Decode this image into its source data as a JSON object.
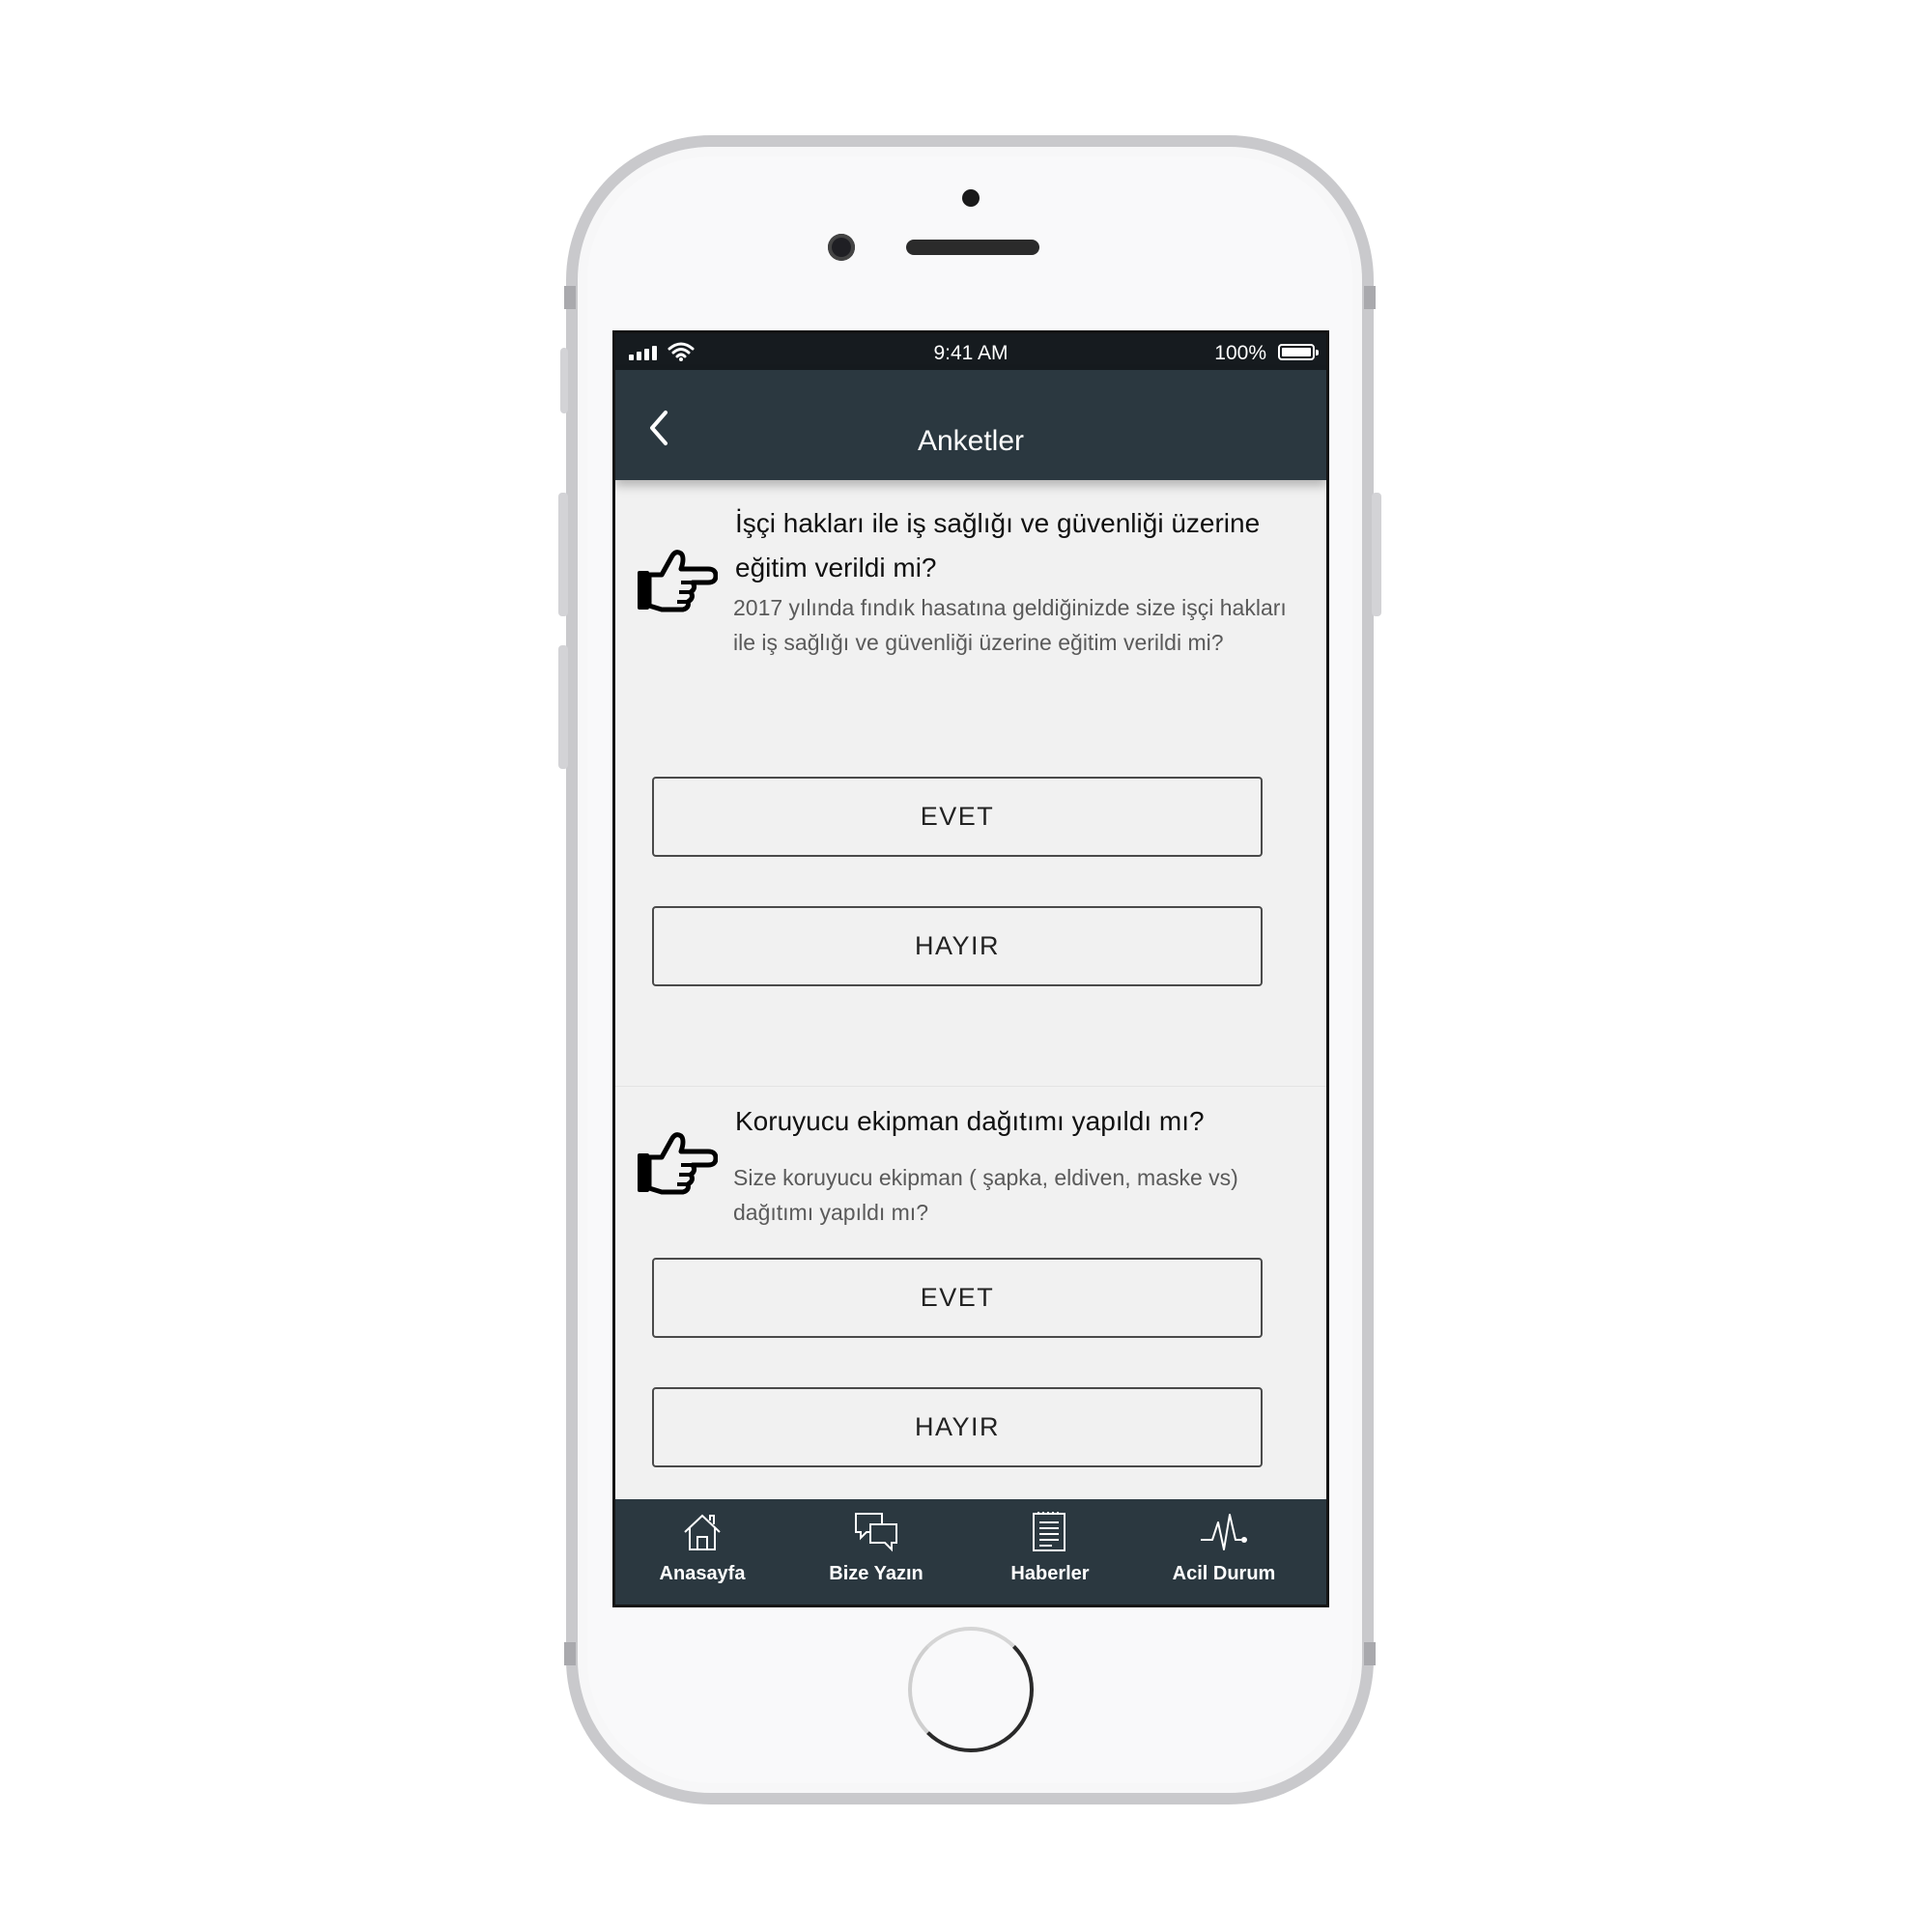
{
  "status_bar": {
    "time": "9:41 AM",
    "battery": "100%"
  },
  "nav": {
    "title": "Anketler"
  },
  "questions": [
    {
      "title": "İşçi hakları ile iş sağlığı ve güvenliği üzerine eğitim verildi mi?",
      "description": "2017 yılında fındık hasatına geldiğinizde size işçi hakları ile iş sağlığı ve güvenliği üzerine eğitim verildi mi?",
      "yes_label": "EVET",
      "no_label": "HAYIR"
    },
    {
      "title": "Koruyucu ekipman dağıtımı yapıldı mı?",
      "description": "Size koruyucu ekipman ( şapka, eldiven, maske vs) dağıtımı yapıldı mı?",
      "yes_label": "EVET",
      "no_label": "HAYIR"
    }
  ],
  "tabs": [
    {
      "label": "Anasayfa",
      "icon": "home-icon"
    },
    {
      "label": "Bize Yazın",
      "icon": "chat-icon"
    },
    {
      "label": "Haberler",
      "icon": "news-icon"
    },
    {
      "label": "Acil Durum",
      "icon": "pulse-icon"
    }
  ],
  "colors": {
    "nav_bg": "#2b3840",
    "status_bg": "#161b1f",
    "content_bg": "#f1f1f1"
  }
}
